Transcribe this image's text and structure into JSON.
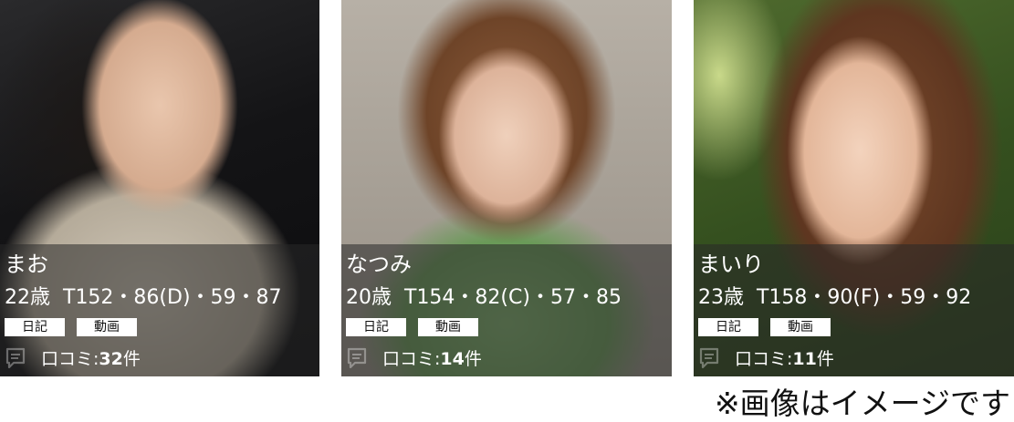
{
  "cards": [
    {
      "name": "まお",
      "age": "22歳",
      "measurements": "T152・86(D)・59・87",
      "tags": [
        "日記",
        "動画"
      ],
      "reviews_label": "口コミ:",
      "reviews_count": "32",
      "reviews_unit": "件"
    },
    {
      "name": "なつみ",
      "age": "20歳",
      "measurements": "T154・82(C)・57・85",
      "tags": [
        "日記",
        "動画"
      ],
      "reviews_label": "口コミ:",
      "reviews_count": "14",
      "reviews_unit": "件"
    },
    {
      "name": "まいり",
      "age": "23歳",
      "measurements": "T158・90(F)・59・92",
      "tags": [
        "日記",
        "動画"
      ],
      "reviews_label": "口コミ:",
      "reviews_count": "11",
      "reviews_unit": "件"
    }
  ],
  "caption": "※画像はイメージです",
  "icons": {
    "review": "comment-icon"
  },
  "colors": {
    "overlay": "#282828",
    "tag_background": "#ffffff",
    "text_light": "#ffffff"
  }
}
